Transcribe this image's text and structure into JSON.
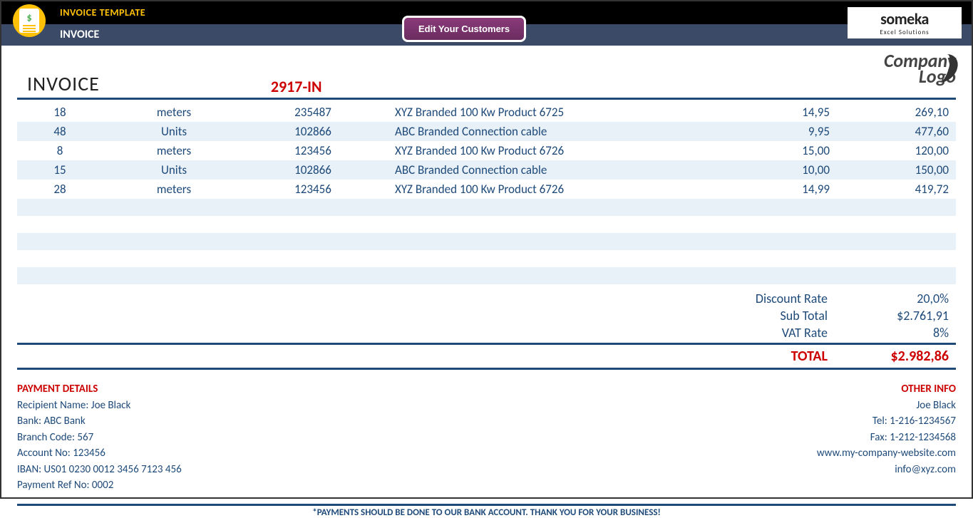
{
  "header": {
    "template_label": "INVOICE TEMPLATE",
    "section_label": "INVOICE",
    "edit_button": "Edit Your Customers",
    "someka_brand": "someka",
    "someka_sub": "Excel Solutions",
    "company_logo_l1": "Company",
    "company_logo_l2": "Logo"
  },
  "invoice": {
    "title": "INVOICE",
    "number": "2917-IN"
  },
  "items": [
    {
      "qty": "18",
      "unit": "meters",
      "code": "235487",
      "desc": "XYZ Branded 100 Kw Product 6725",
      "price": "14,95",
      "amount": "269,10"
    },
    {
      "qty": "48",
      "unit": "Units",
      "code": "102866",
      "desc": "ABC Branded Connection cable",
      "price": "9,95",
      "amount": "477,60"
    },
    {
      "qty": "8",
      "unit": "meters",
      "code": "123456",
      "desc": "XYZ Branded 100 Kw Product 6726",
      "price": "15,00",
      "amount": "120,00"
    },
    {
      "qty": "15",
      "unit": "Units",
      "code": "102866",
      "desc": "ABC Branded Connection cable",
      "price": "10,00",
      "amount": "150,00"
    },
    {
      "qty": "28",
      "unit": "meters",
      "code": "123456",
      "desc": "XYZ Branded 100 Kw Product 6726",
      "price": "14,99",
      "amount": "419,72"
    }
  ],
  "summary": {
    "discount_label": "Discount Rate",
    "discount_val": "20,0%",
    "subtotal_label": "Sub Total",
    "subtotal_val": "$2.761,91",
    "vat_label": "VAT Rate",
    "vat_val": "8%",
    "total_label": "TOTAL",
    "total_val": "$2.982,86"
  },
  "payment": {
    "heading": "PAYMENT DETAILS",
    "recipient": "Recipient Name: Joe Black",
    "bank": "Bank: ABC Bank",
    "branch": "Branch Code: 567",
    "account": "Account No: 123456",
    "iban": "IBAN: US01 0230 0012 3456 7123 456",
    "ref": "Payment Ref No: 0002"
  },
  "other": {
    "heading": "OTHER INFO",
    "name": "Joe Black",
    "tel": "Tel: 1-216-1234567",
    "fax": "Fax: 1-212-1234568",
    "web": "www.my-company-website.com",
    "email": "info@xyz.com"
  },
  "footer": "*PAYMENTS SHOULD BE DONE TO OUR BANK ACCOUNT. THANK YOU FOR YOUR BUSINESS!"
}
